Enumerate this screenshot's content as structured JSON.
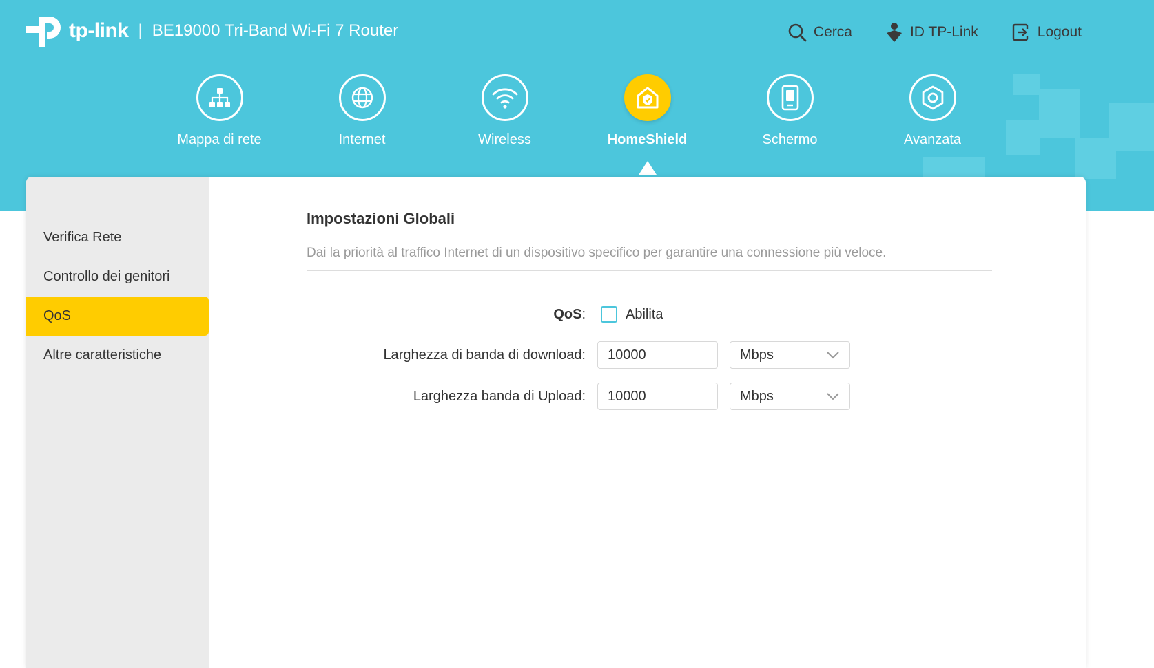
{
  "header": {
    "brand": "tp-link",
    "separator": "|",
    "model": "BE19000 Tri-Band Wi-Fi 7 Router",
    "actions": [
      {
        "label": "Cerca",
        "icon": "search-icon"
      },
      {
        "label": "ID TP-Link",
        "icon": "tplink-id-icon"
      },
      {
        "label": "Logout",
        "icon": "logout-icon"
      }
    ]
  },
  "nav": {
    "items": [
      {
        "label": "Mappa di rete",
        "icon": "network-map-icon"
      },
      {
        "label": "Internet",
        "icon": "globe-icon"
      },
      {
        "label": "Wireless",
        "icon": "wifi-icon"
      },
      {
        "label": "HomeShield",
        "icon": "homeshield-icon",
        "active": true
      },
      {
        "label": "Schermo",
        "icon": "screen-icon"
      },
      {
        "label": "Avanzata",
        "icon": "gear-icon"
      }
    ]
  },
  "sidebar": {
    "items": [
      {
        "label": "Verifica Rete"
      },
      {
        "label": "Controllo dei genitori"
      },
      {
        "label": "QoS",
        "active": true
      },
      {
        "label": "Altre caratteristiche"
      }
    ]
  },
  "content": {
    "title": "Impostazioni Globali",
    "description": "Dai la priorità al traffico Internet di un dispositivo specifico per garantire una connessione più veloce.",
    "qos": {
      "label": "QoS",
      "colon": ":",
      "checkbox_label": "Abilita",
      "checked": false
    },
    "download": {
      "label": "Larghezza di banda di download:",
      "value": "10000",
      "unit": "Mbps"
    },
    "upload": {
      "label": "Larghezza banda di Upload:",
      "value": "10000",
      "unit": "Mbps"
    }
  },
  "colors": {
    "header_bg": "#4cc6dc",
    "accent": "#ffcc00",
    "sidebar_bg": "#ebebeb"
  }
}
